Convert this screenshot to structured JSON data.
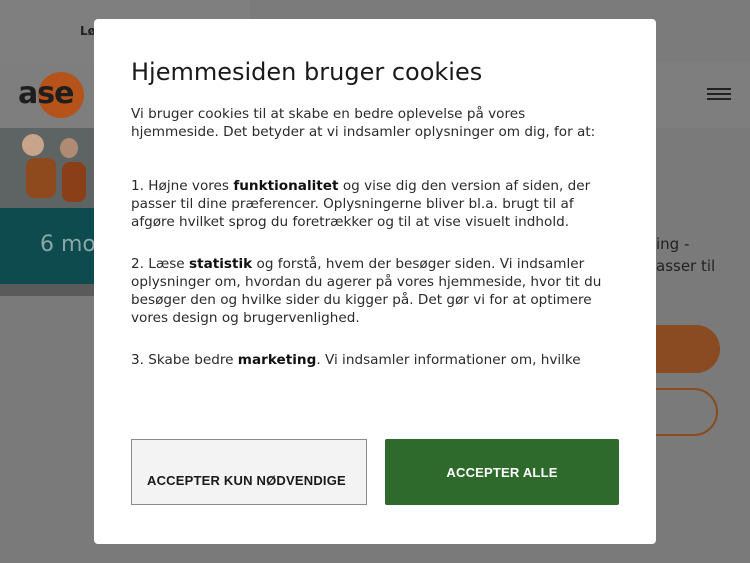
{
  "background": {
    "topbar_link": "Lø",
    "logo_text": "ase",
    "hero_text": "6 mo",
    "right_text_line1": "ing -",
    "right_text_line2": "asser til"
  },
  "modal": {
    "title": "Hjemmesiden bruger cookies",
    "intro": "Vi bruger cookies til at skabe en bedre oplevelse på vores hjemmeside. Det betyder at vi indsamler oplysninger om dig, for at:",
    "items": [
      {
        "prefix": "1. Højne vores ",
        "bold": "funktionalitet",
        "suffix": " og vise dig den version af siden, der passer til dine præferencer. Oplysningerne bliver bl.a. brugt til af afgøre hvilket sprog du foretrækker og til at vise visuelt indhold."
      },
      {
        "prefix": "2. Læse ",
        "bold": "statistik",
        "suffix": " og forstå, hvem der besøger siden. Vi indsamler oplysninger om, hvordan du agerer på vores hjemmeside, hvor tit du besøger den og hvilke sider du kigger på. Det gør vi for at optimere vores design og brugervenlighed."
      },
      {
        "prefix": "3. Skabe bedre ",
        "bold": "marketing",
        "suffix": ". Vi indsamler informationer om, hvilke"
      }
    ],
    "button_necessary": "ACCEPTER KUN NØDVENDIGE",
    "button_all": "ACCEPTER ALLE"
  },
  "colors": {
    "accept_all_bg": "#2e6a2b",
    "brand_orange": "#b5531a",
    "overlay": "#7a7a7a"
  }
}
